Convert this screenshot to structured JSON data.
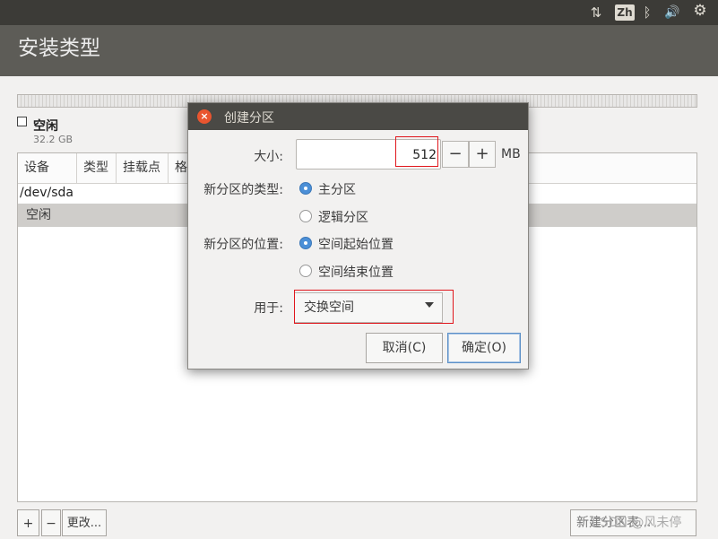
{
  "window": {
    "title": "安装类型"
  },
  "topbar": {
    "sort_icon": "⇅",
    "keyboard_layout": "Zh",
    "bluetooth_icon": "ᛒ",
    "volume_icon": "🔊",
    "gear_icon": "⚙"
  },
  "legend": {
    "name": "空闲",
    "size": "32.2 GB"
  },
  "table": {
    "headers": [
      "设备",
      "类型",
      "挂载点",
      "格"
    ],
    "device_row": "/dev/sda",
    "free_row": "空闲"
  },
  "toolbar": {
    "add": "+",
    "remove": "−",
    "change": "更改...",
    "new_table": "新建分区表..."
  },
  "watermark": "CSDN @风未停",
  "dialog": {
    "title": "创建分区",
    "close_icon": "×",
    "size_label": "大小:",
    "size_value": "512",
    "minus": "−",
    "plus": "+",
    "unit": "MB",
    "type_label": "新分区的类型:",
    "type_primary": "主分区",
    "type_logical": "逻辑分区",
    "location_label": "新分区的位置:",
    "location_begin": "空间起始位置",
    "location_end": "空间结束位置",
    "use_label": "用于:",
    "use_value": "交换空间",
    "cancel": "取消(C)",
    "ok": "确定(O)"
  }
}
